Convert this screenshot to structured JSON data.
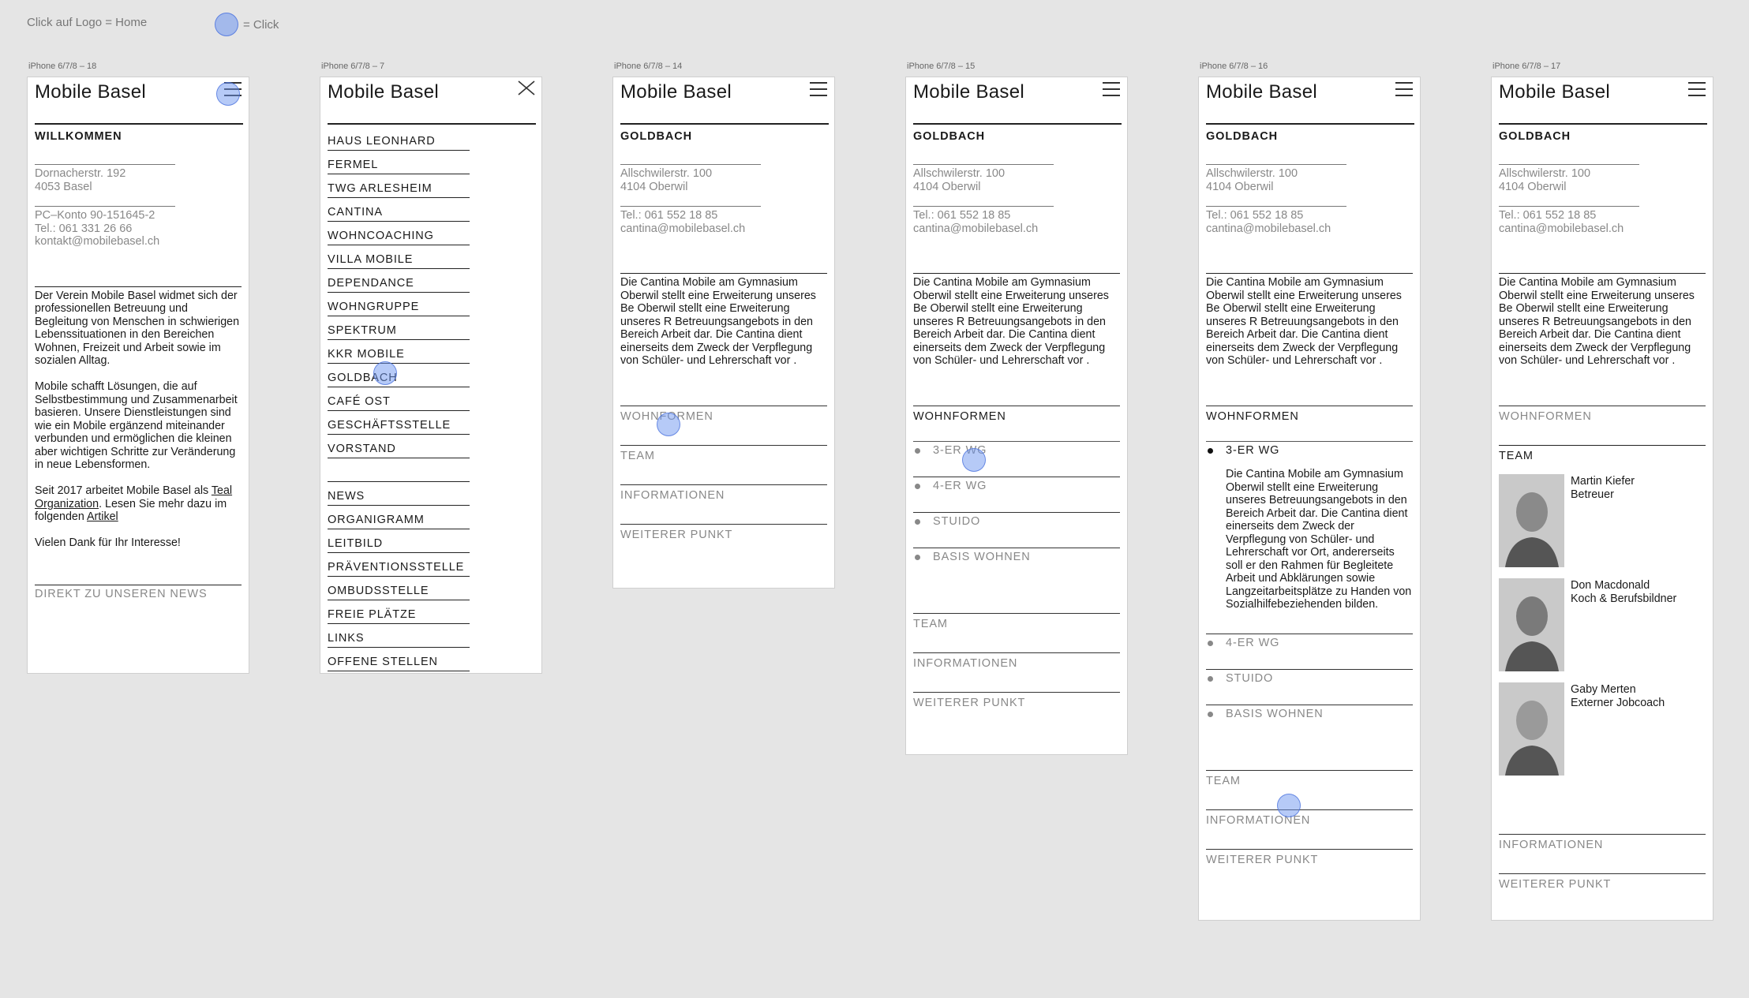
{
  "legend": {
    "logo_home": "Click auf Logo = Home",
    "click_label": "= Click"
  },
  "logo": "Mobile Basel",
  "frames": {
    "f18": {
      "label": "iPhone 6/7/8 – 18",
      "title": "WILLKOMMEN",
      "addr1": [
        "Dornacherstr. 192",
        "4053 Basel"
      ],
      "addr2": [
        "PC–Konto 90-151645-2",
        "Tel.: 061 331 26 66",
        "kontakt@mobilebasel.ch"
      ],
      "p1": "Der Verein Mobile Basel widmet sich der professionellen Betreuung und Begleitung von Menschen in schwierigen Lebenssituationen in den Bereichen Wohnen, Freizeit und Arbeit sowie im sozialen Alltag.",
      "p2": "Mobile schafft Lösungen, die auf Selbstbestimmung und Zusammenarbeit basieren. Unsere Dienstleistungen sind wie ein Mobile ergänzend miteinander verbunden und ermöglichen die kleinen aber wichtigen Schritte zur Veränderung in neue Lebensformen.",
      "p3_a": "Seit 2017 arbeitet Mobile Basel als ",
      "p3_link1": "Teal Organization",
      "p3_b": ". Lesen Sie mehr dazu im folgenden ",
      "p3_link2": "Artikel",
      "p4": "Vielen Dank für Ihr Interesse!",
      "news_link": "DIREKT ZU UNSEREN NEWS"
    },
    "f7": {
      "label": "iPhone 6/7/8 – 7",
      "menu1": [
        "HAUS LEONHARD",
        "FERMEL",
        "TWG ARLESHEIM",
        "CANTINA",
        "WOHNCOACHING",
        "VILLA MOBILE",
        "DEPENDANCE",
        "WOHNGRUPPE",
        "SPEKTRUM",
        "KKR MOBILE",
        "GOLDBACH",
        "CAFÉ OST",
        "GESCHÄFTSSTELLE",
        "VORSTAND"
      ],
      "menu2": [
        "NEWS",
        "ORGANIGRAMM",
        "LEITBILD",
        "PRÄVENTIONSSTELLE",
        "OMBUDSSTELLE",
        "FREIE PLÄTZE",
        "LINKS",
        "OFFENE STELLEN"
      ]
    },
    "common": {
      "title": "GOLDBACH",
      "addr1": [
        "Allschwilerstr. 100",
        "4104 Oberwil"
      ],
      "addr2": [
        "Tel.: 061 552 18 85",
        "cantina@mobilebasel.ch"
      ],
      "desc": "Die Cantina Mobile am Gymnasium Oberwil stellt eine Erweiterung unseres Be Oberwil stellt eine Erweiterung unseres R Betreuungsangebots in den Bereich Arbeit dar. Die Cantina dient einerseits dem Zweck der Verpflegung von Schüler- und Lehrerschaft vor .",
      "sections": [
        "WOHNFORMEN",
        "TEAM",
        "INFORMATIONEN",
        "WEITERER PUNKT"
      ],
      "sub_items": [
        "3-ER WG",
        "4-ER WG",
        "STUIDO",
        "BASIS WOHNEN"
      ],
      "sub_desc": "Die Cantina Mobile am Gymnasium Oberwil stellt eine Erweiterung unseres Betreuungsangebots in den Bereich Arbeit dar. Die Cantina dient einerseits dem Zweck der Verpflegung von Schüler- und Lehrerschaft vor Ort, andererseits soll er den Rahmen für Begleitete Arbeit und Abklärungen sowie Langzeitarbeitsplätze zu Handen von Sozialhilfebeziehenden bilden."
    },
    "f14": {
      "label": "iPhone 6/7/8 – 14"
    },
    "f15": {
      "label": "iPhone 6/7/8 – 15"
    },
    "f16": {
      "label": "iPhone 6/7/8 – 16"
    },
    "f17": {
      "label": "iPhone 6/7/8 – 17",
      "team": [
        {
          "name": "Martin Kiefer",
          "role": "Betreuer"
        },
        {
          "name": "Don Macdonald",
          "role": "Koch & Berufsbildner"
        },
        {
          "name": "Gaby Merten",
          "role": "Externer Jobcoach"
        }
      ]
    }
  },
  "colors": {
    "background": "#e5e5e5",
    "click_marker": "#7a9cf0",
    "muted_text": "#888888"
  }
}
